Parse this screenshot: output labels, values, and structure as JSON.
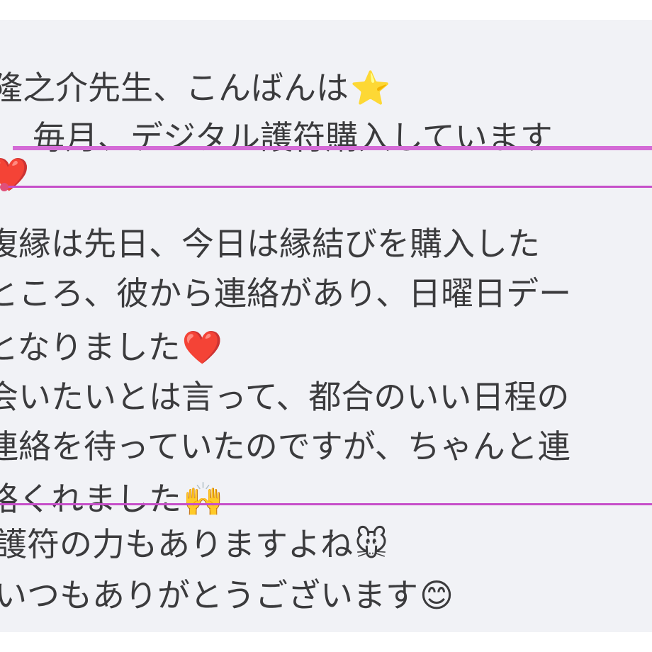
{
  "message": {
    "lines": [
      "隆之介先生、こんばんは",
      "　毎月、デジタル護符購入しています",
      "",
      "復縁は先日、今日は縁結びを購入した",
      "ところ、彼から連絡があり、日曜日デー",
      "となりました",
      "会いたいとは言って、都合のいい日程の",
      "連絡を待っていたのですが、ちゃんと連",
      "絡くれました",
      "護符の力もありますよね",
      "いつもありがとうございます"
    ],
    "emojis": {
      "star": "⭐",
      "heart1": "❤️",
      "heart2": "❤️",
      "mickey_cheer": "🙌",
      "mickey_face": "🐭",
      "smile": "😊"
    }
  },
  "colors": {
    "card_background": "#f1f2f6",
    "text": "#3b3b3d",
    "highlight_rule": "#c64fc9"
  }
}
